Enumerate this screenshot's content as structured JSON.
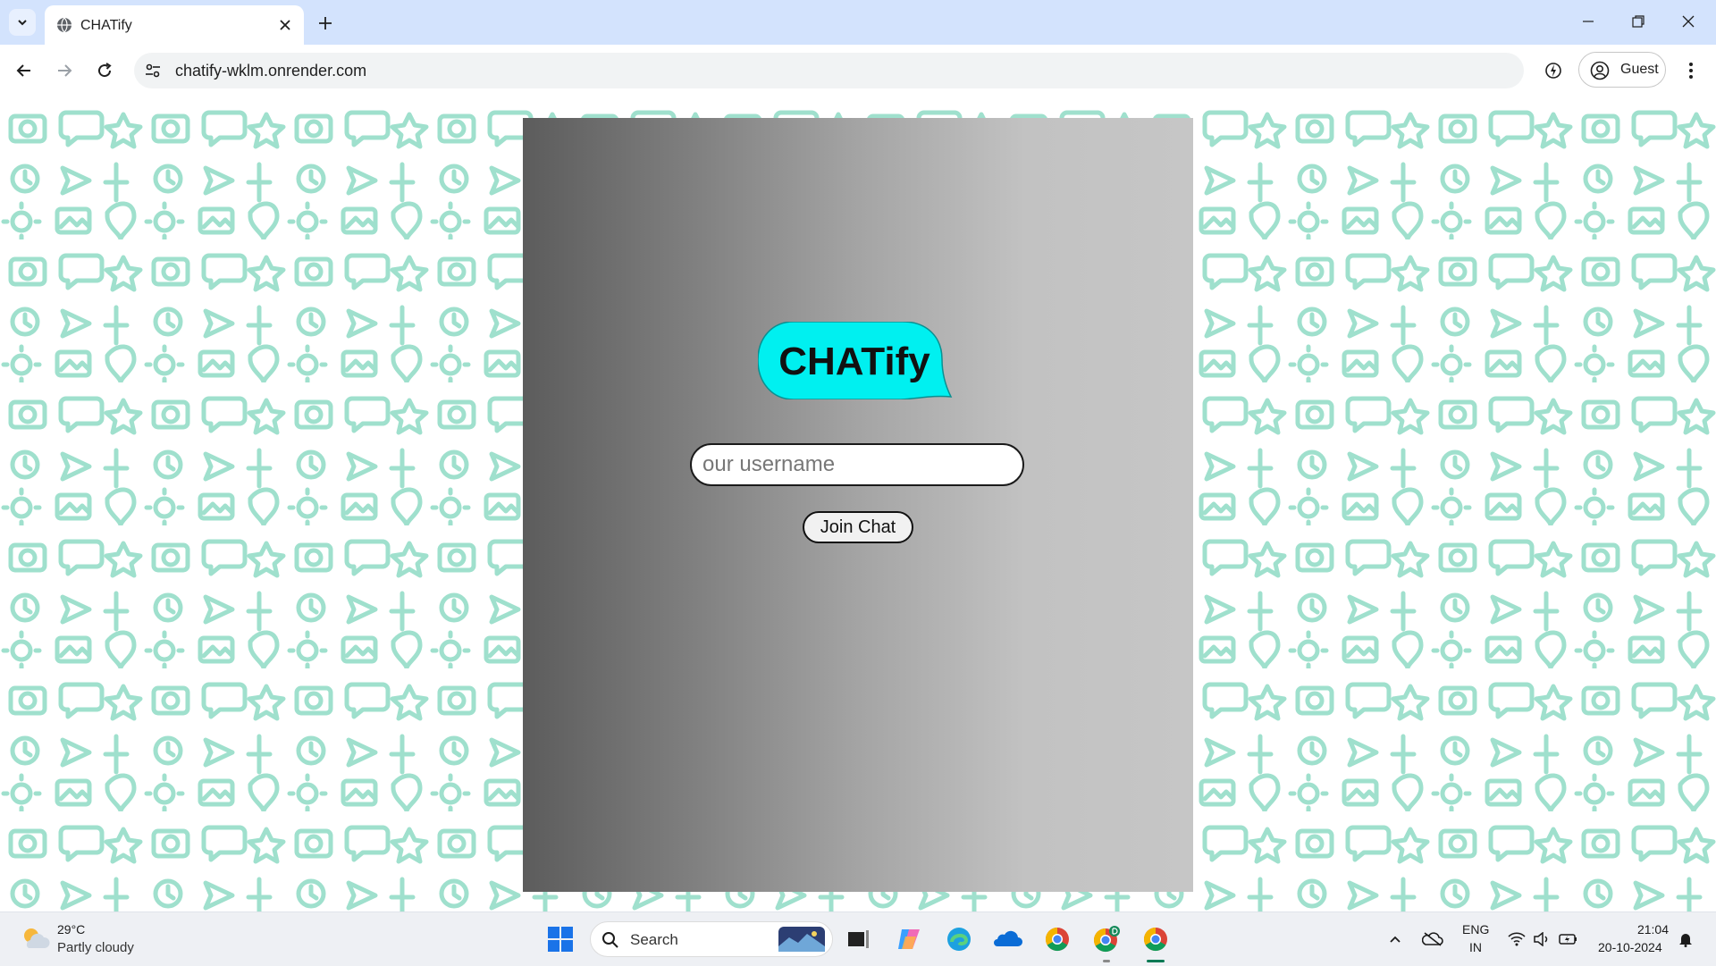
{
  "browser": {
    "tab": {
      "title": "CHATify"
    },
    "address": {
      "url": "chatify-wklm.onrender.com"
    },
    "profile": {
      "label": "Guest"
    }
  },
  "page": {
    "logo_text": "CHATify",
    "username_input": {
      "value": "",
      "placeholder": "our username"
    },
    "join_button": "Join Chat",
    "colors": {
      "pattern": "#9fe0cd",
      "logo_bubble": "#00f0f0"
    }
  },
  "taskbar": {
    "weather": {
      "temperature": "29°C",
      "condition": "Partly cloudy"
    },
    "search_label": "Search",
    "language": {
      "line1": "ENG",
      "line2": "IN"
    },
    "clock": {
      "time": "21:04",
      "date": "20-10-2024"
    },
    "apps": [
      "start-icon",
      "search",
      "task-view-icon",
      "copilot-icon",
      "edge-icon",
      "onedrive-icon",
      "chrome-icon",
      "chrome-profile-icon",
      "chrome-active-icon"
    ]
  }
}
